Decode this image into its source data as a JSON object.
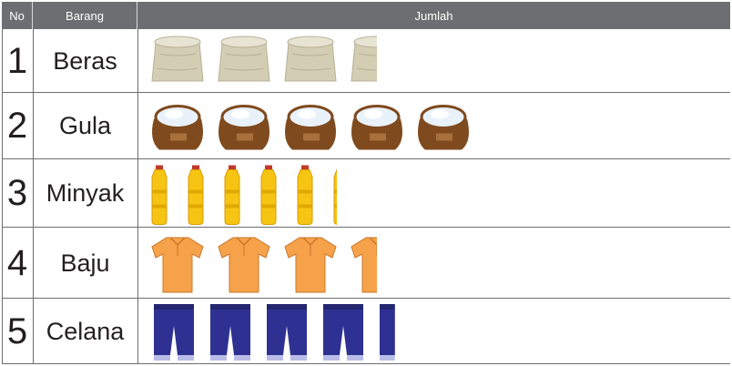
{
  "table": {
    "header": {
      "no": "No",
      "barang": "Barang",
      "jumlah": "Jumlah"
    }
  },
  "chart_data": {
    "type": "pictograph",
    "header": [
      "No",
      "Barang",
      "Jumlah"
    ],
    "categories": [
      "Beras",
      "Gula",
      "Minyak",
      "Baju",
      "Celana"
    ],
    "numbers": [
      "1",
      "2",
      "3",
      "4",
      "5"
    ],
    "values": [
      3.5,
      5,
      5.25,
      3.5,
      4.4
    ],
    "icons": [
      "rice-sack-icon",
      "sugar-sack-icon",
      "oil-bottle-icon",
      "shirt-icon",
      "pants-icon"
    ]
  },
  "colors": {
    "header_bg": "#6d6e71",
    "header_text": "#ffffff",
    "grid": "#6d6e71",
    "rice_sack": "#d3cdb3",
    "sugar_sack": "#7f4a1e",
    "oil_bottle": "#f6c514",
    "shirt": "#f6a24a",
    "pants": "#2e3192"
  }
}
